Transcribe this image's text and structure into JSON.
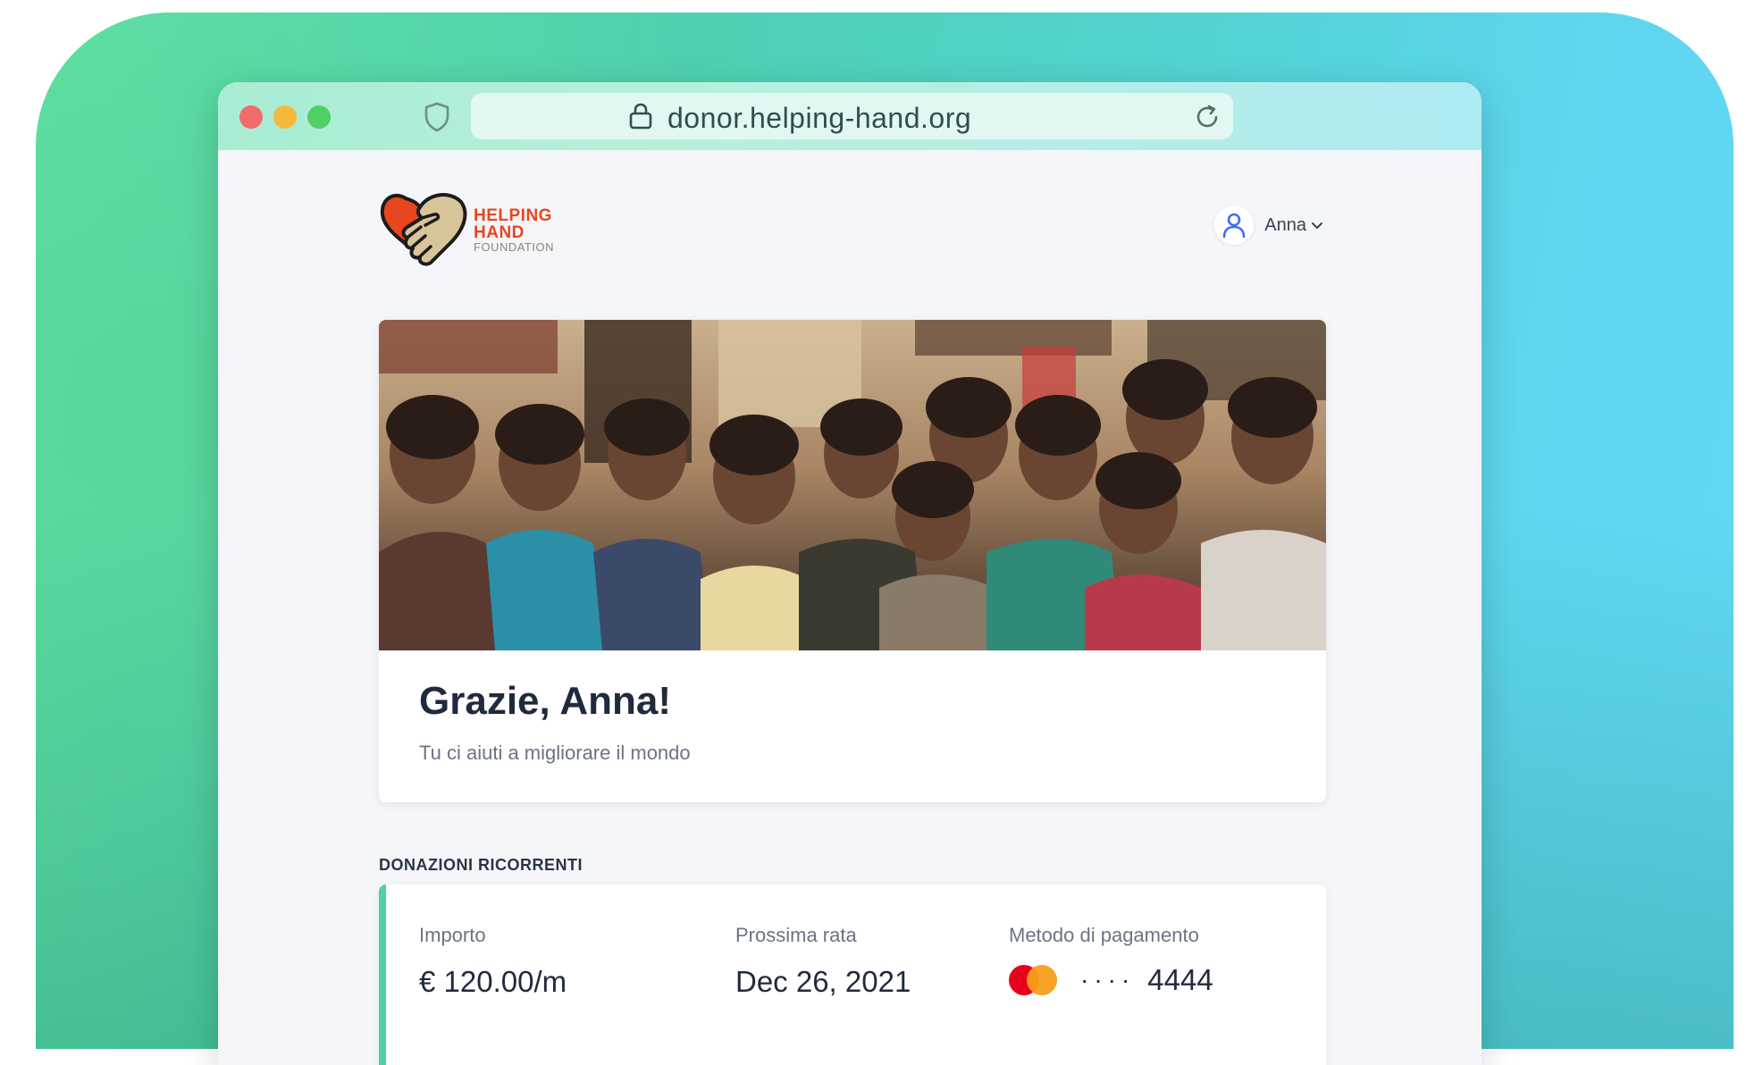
{
  "browser": {
    "url": "donor.helping-hand.org"
  },
  "brand": {
    "line1": "HELPING",
    "line2": "HAND",
    "line3": "FOUNDATION"
  },
  "user": {
    "name": "Anna"
  },
  "hero": {
    "title": "Grazie, Anna!",
    "subtitle": "Tu ci aiuti a migliorare il mondo"
  },
  "recurring": {
    "section_label": "DONAZIONI RICORRENTI",
    "amount_label": "Importo",
    "amount_value": "€ 120.00/m",
    "next_label": "Prossima rata",
    "next_value": "Dec 26, 2021",
    "method_label": "Metodo di pagamento",
    "card_masked": "····",
    "card_last4": "4444"
  },
  "colors": {
    "accent": "#4fd0a6",
    "brand_red": "#e8461e"
  }
}
